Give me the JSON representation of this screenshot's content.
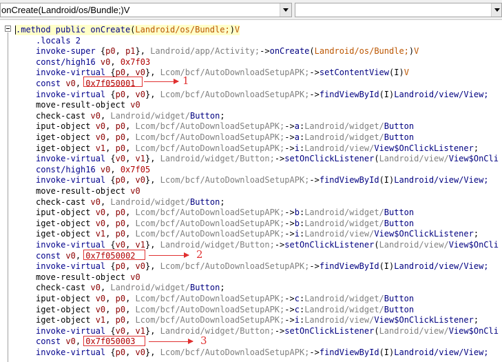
{
  "toolbar": {
    "method_selector": "onCreate(Landroid/os/Bundle;)V",
    "class_selector": ""
  },
  "code": {
    "lines": [
      [
        [
          ".method public ",
          "k"
        ],
        [
          "onCreate",
          "m"
        ],
        [
          "(",
          "o"
        ],
        [
          "Landroid/os/Bundle;",
          "d"
        ],
        [
          ")",
          "o"
        ],
        [
          "V",
          "d"
        ]
      ],
      [
        [
          ".locals 2",
          "k"
        ]
      ],
      [
        [
          "invoke-super ",
          "k"
        ],
        [
          "{",
          "o"
        ],
        [
          "p0",
          "n"
        ],
        [
          ", ",
          "o"
        ],
        [
          "p1",
          "n"
        ],
        [
          "}, ",
          "o"
        ],
        [
          "Landroid/app/Activity;",
          "p"
        ],
        [
          "->",
          "o"
        ],
        [
          "onCreate",
          "m"
        ],
        [
          "(",
          "o"
        ],
        [
          "Landroid/os/Bundle;",
          "d"
        ],
        [
          ")",
          "o"
        ],
        [
          "V",
          "d"
        ]
      ],
      [
        [
          "const/high16 ",
          "k"
        ],
        [
          "v0",
          "n"
        ],
        [
          ", ",
          "o"
        ],
        [
          "0x7f03",
          "r"
        ]
      ],
      [
        [
          "invoke-virtual ",
          "k"
        ],
        [
          "{",
          "o"
        ],
        [
          "p0",
          "n"
        ],
        [
          ", ",
          "o"
        ],
        [
          "v0",
          "n"
        ],
        [
          "}, ",
          "o"
        ],
        [
          "Lcom/bcf/AutoDownloadSetupAPK;",
          "p"
        ],
        [
          "->",
          "o"
        ],
        [
          "setContentView",
          "m"
        ],
        [
          "(I)",
          "o"
        ],
        [
          "V",
          "d"
        ]
      ],
      [
        [
          "const ",
          "k"
        ],
        [
          "v0",
          "n"
        ],
        [
          ", ",
          "o"
        ],
        [
          "0x7f050001",
          "r"
        ]
      ],
      [
        [
          "invoke-virtual ",
          "k"
        ],
        [
          "{",
          "o"
        ],
        [
          "p0",
          "n"
        ],
        [
          ", ",
          "o"
        ],
        [
          "v0",
          "n"
        ],
        [
          "}, ",
          "o"
        ],
        [
          "Lcom/bcf/AutoDownloadSetupAPK;",
          "p"
        ],
        [
          "->",
          "o"
        ],
        [
          "findViewById",
          "m"
        ],
        [
          "(I)",
          "o"
        ],
        [
          "Landroid/view/View;",
          "m"
        ]
      ],
      [
        [
          "move-result-object ",
          "t"
        ],
        [
          "v0",
          "n"
        ]
      ],
      [
        [
          "check-cast ",
          "t"
        ],
        [
          "v0",
          "n"
        ],
        [
          ", ",
          "o"
        ],
        [
          "Landroid/widget/",
          "p"
        ],
        [
          "Button",
          "m"
        ],
        [
          ";",
          "o"
        ]
      ],
      [
        [
          "iput-object ",
          "t"
        ],
        [
          "v0",
          "n"
        ],
        [
          ", ",
          "o"
        ],
        [
          "p0",
          "n"
        ],
        [
          ", ",
          "o"
        ],
        [
          "Lcom/bcf/AutoDownloadSetupAPK;",
          "p"
        ],
        [
          "->",
          "o"
        ],
        [
          "a",
          "m"
        ],
        [
          ":",
          "o"
        ],
        [
          "Landroid/widget/",
          "p"
        ],
        [
          "Button",
          "m"
        ]
      ],
      [
        [
          "iget-object ",
          "t"
        ],
        [
          "v0",
          "n"
        ],
        [
          ", ",
          "o"
        ],
        [
          "p0",
          "n"
        ],
        [
          ", ",
          "o"
        ],
        [
          "Lcom/bcf/AutoDownloadSetupAPK;",
          "p"
        ],
        [
          "->",
          "o"
        ],
        [
          "a",
          "m"
        ],
        [
          ":",
          "o"
        ],
        [
          "Landroid/widget/",
          "p"
        ],
        [
          "Button",
          "m"
        ]
      ],
      [
        [
          "iget-object ",
          "t"
        ],
        [
          "v1",
          "n"
        ],
        [
          ", ",
          "o"
        ],
        [
          "p0",
          "n"
        ],
        [
          ", ",
          "o"
        ],
        [
          "Lcom/bcf/AutoDownloadSetupAPK;",
          "p"
        ],
        [
          "->",
          "o"
        ],
        [
          "i",
          "m"
        ],
        [
          ":",
          "o"
        ],
        [
          "Landroid/view/",
          "p"
        ],
        [
          "View$OnClickListener",
          "m"
        ],
        [
          ";",
          "o"
        ]
      ],
      [
        [
          "invoke-virtual ",
          "k"
        ],
        [
          "{",
          "o"
        ],
        [
          "v0",
          "n"
        ],
        [
          ", ",
          "o"
        ],
        [
          "v1",
          "n"
        ],
        [
          "}, ",
          "o"
        ],
        [
          "Landroid/widget/Button;",
          "p"
        ],
        [
          "->",
          "o"
        ],
        [
          "setOnClickListener",
          "m"
        ],
        [
          "(",
          "o"
        ],
        [
          "Landroid/view/",
          "p"
        ],
        [
          "View$OnCli",
          "m"
        ]
      ],
      [
        [
          "const/high16 ",
          "k"
        ],
        [
          "v0",
          "n"
        ],
        [
          ", ",
          "o"
        ],
        [
          "0x7f05",
          "r"
        ]
      ],
      [
        [
          "invoke-virtual ",
          "k"
        ],
        [
          "{",
          "o"
        ],
        [
          "p0",
          "n"
        ],
        [
          ", ",
          "o"
        ],
        [
          "v0",
          "n"
        ],
        [
          "}, ",
          "o"
        ],
        [
          "Lcom/bcf/AutoDownloadSetupAPK;",
          "p"
        ],
        [
          "->",
          "o"
        ],
        [
          "findViewById",
          "m"
        ],
        [
          "(I)",
          "o"
        ],
        [
          "Landroid/view/View;",
          "m"
        ]
      ],
      [
        [
          "move-result-object ",
          "t"
        ],
        [
          "v0",
          "n"
        ]
      ],
      [
        [
          "check-cast ",
          "t"
        ],
        [
          "v0",
          "n"
        ],
        [
          ", ",
          "o"
        ],
        [
          "Landroid/widget/",
          "p"
        ],
        [
          "Button",
          "m"
        ],
        [
          ";",
          "o"
        ]
      ],
      [
        [
          "iput-object ",
          "t"
        ],
        [
          "v0",
          "n"
        ],
        [
          ", ",
          "o"
        ],
        [
          "p0",
          "n"
        ],
        [
          ", ",
          "o"
        ],
        [
          "Lcom/bcf/AutoDownloadSetupAPK;",
          "p"
        ],
        [
          "->",
          "o"
        ],
        [
          "b",
          "m"
        ],
        [
          ":",
          "o"
        ],
        [
          "Landroid/widget/",
          "p"
        ],
        [
          "Button",
          "m"
        ]
      ],
      [
        [
          "iget-object ",
          "t"
        ],
        [
          "v0",
          "n"
        ],
        [
          ", ",
          "o"
        ],
        [
          "p0",
          "n"
        ],
        [
          ", ",
          "o"
        ],
        [
          "Lcom/bcf/AutoDownloadSetupAPK;",
          "p"
        ],
        [
          "->",
          "o"
        ],
        [
          "b",
          "m"
        ],
        [
          ":",
          "o"
        ],
        [
          "Landroid/widget/",
          "p"
        ],
        [
          "Button",
          "m"
        ]
      ],
      [
        [
          "iget-object ",
          "t"
        ],
        [
          "v1",
          "n"
        ],
        [
          ", ",
          "o"
        ],
        [
          "p0",
          "n"
        ],
        [
          ", ",
          "o"
        ],
        [
          "Lcom/bcf/AutoDownloadSetupAPK;",
          "p"
        ],
        [
          "->",
          "o"
        ],
        [
          "i",
          "m"
        ],
        [
          ":",
          "o"
        ],
        [
          "Landroid/view/",
          "p"
        ],
        [
          "View$OnClickListener",
          "m"
        ],
        [
          ";",
          "o"
        ]
      ],
      [
        [
          "invoke-virtual ",
          "k"
        ],
        [
          "{",
          "o"
        ],
        [
          "v0",
          "n"
        ],
        [
          ", ",
          "o"
        ],
        [
          "v1",
          "n"
        ],
        [
          "}, ",
          "o"
        ],
        [
          "Landroid/widget/Button;",
          "p"
        ],
        [
          "->",
          "o"
        ],
        [
          "setOnClickListener",
          "m"
        ],
        [
          "(",
          "o"
        ],
        [
          "Landroid/view/",
          "p"
        ],
        [
          "View$OnCli",
          "m"
        ]
      ],
      [
        [
          "const ",
          "k"
        ],
        [
          "v0",
          "n"
        ],
        [
          ", ",
          "o"
        ],
        [
          "0x7f050002",
          "r"
        ]
      ],
      [
        [
          "invoke-virtual ",
          "k"
        ],
        [
          "{",
          "o"
        ],
        [
          "p0",
          "n"
        ],
        [
          ", ",
          "o"
        ],
        [
          "v0",
          "n"
        ],
        [
          "}, ",
          "o"
        ],
        [
          "Lcom/bcf/AutoDownloadSetupAPK;",
          "p"
        ],
        [
          "->",
          "o"
        ],
        [
          "findViewById",
          "m"
        ],
        [
          "(I)",
          "o"
        ],
        [
          "Landroid/view/View;",
          "m"
        ]
      ],
      [
        [
          "move-result-object ",
          "t"
        ],
        [
          "v0",
          "n"
        ]
      ],
      [
        [
          "check-cast ",
          "t"
        ],
        [
          "v0",
          "n"
        ],
        [
          ", ",
          "o"
        ],
        [
          "Landroid/widget/",
          "p"
        ],
        [
          "Button",
          "m"
        ],
        [
          ";",
          "o"
        ]
      ],
      [
        [
          "iput-object ",
          "t"
        ],
        [
          "v0",
          "n"
        ],
        [
          ", ",
          "o"
        ],
        [
          "p0",
          "n"
        ],
        [
          ", ",
          "o"
        ],
        [
          "Lcom/bcf/AutoDownloadSetupAPK;",
          "p"
        ],
        [
          "->",
          "o"
        ],
        [
          "c",
          "m"
        ],
        [
          ":",
          "o"
        ],
        [
          "Landroid/widget/",
          "p"
        ],
        [
          "Button",
          "m"
        ]
      ],
      [
        [
          "iget-object ",
          "t"
        ],
        [
          "v0",
          "n"
        ],
        [
          ", ",
          "o"
        ],
        [
          "p0",
          "n"
        ],
        [
          ", ",
          "o"
        ],
        [
          "Lcom/bcf/AutoDownloadSetupAPK;",
          "p"
        ],
        [
          "->",
          "o"
        ],
        [
          "c",
          "m"
        ],
        [
          ":",
          "o"
        ],
        [
          "Landroid/widget/",
          "p"
        ],
        [
          "Button",
          "m"
        ]
      ],
      [
        [
          "iget-object ",
          "t"
        ],
        [
          "v1",
          "n"
        ],
        [
          ", ",
          "o"
        ],
        [
          "p0",
          "n"
        ],
        [
          ", ",
          "o"
        ],
        [
          "Lcom/bcf/AutoDownloadSetupAPK;",
          "p"
        ],
        [
          "->",
          "o"
        ],
        [
          "i",
          "m"
        ],
        [
          ":",
          "o"
        ],
        [
          "Landroid/view/",
          "p"
        ],
        [
          "View$OnClickListener",
          "m"
        ],
        [
          ";",
          "o"
        ]
      ],
      [
        [
          "invoke-virtual ",
          "k"
        ],
        [
          "{",
          "o"
        ],
        [
          "v0",
          "n"
        ],
        [
          ", ",
          "o"
        ],
        [
          "v1",
          "n"
        ],
        [
          "}, ",
          "o"
        ],
        [
          "Landroid/widget/Button;",
          "p"
        ],
        [
          "->",
          "o"
        ],
        [
          "setOnClickListener",
          "m"
        ],
        [
          "(",
          "o"
        ],
        [
          "Landroid/view/",
          "p"
        ],
        [
          "View$OnCli",
          "m"
        ]
      ],
      [
        [
          "const ",
          "k"
        ],
        [
          "v0",
          "n"
        ],
        [
          ", ",
          "o"
        ],
        [
          "0x7f050003",
          "r"
        ]
      ],
      [
        [
          "invoke-virtual ",
          "k"
        ],
        [
          "{",
          "o"
        ],
        [
          "p0",
          "n"
        ],
        [
          ", ",
          "o"
        ],
        [
          "v0",
          "n"
        ],
        [
          "}, ",
          "o"
        ],
        [
          "Lcom/bcf/AutoDownloadSetupAPK;",
          "p"
        ],
        [
          "->",
          "o"
        ],
        [
          "findViewById",
          "m"
        ],
        [
          "(I)",
          "o"
        ],
        [
          "Landroid/view/View;",
          "m"
        ]
      ]
    ]
  },
  "annotations": {
    "labels": [
      "1",
      "2",
      "3"
    ]
  }
}
